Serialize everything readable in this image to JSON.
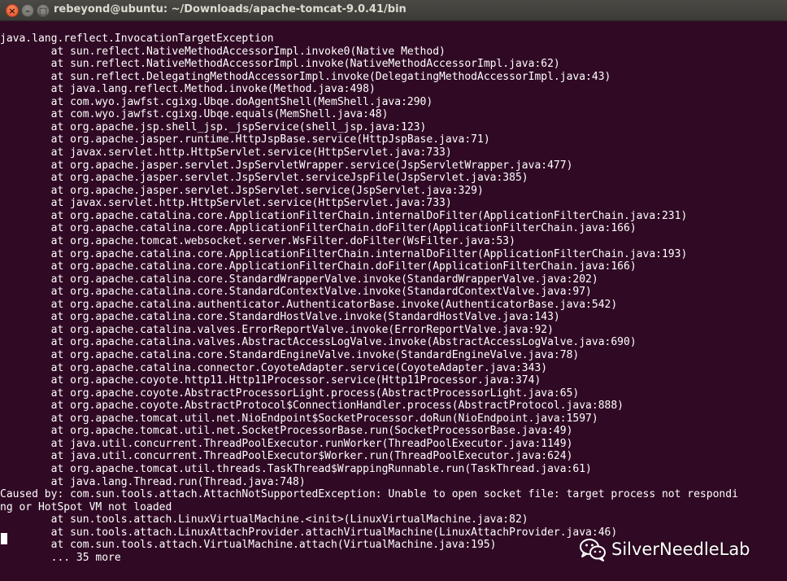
{
  "window": {
    "title": "rebeyond@ubuntu: ~/Downloads/apache-tomcat-9.0.41/bin",
    "close_glyph": "×",
    "minimize_glyph": "–",
    "maximize_glyph": "□"
  },
  "terminal": {
    "lines": [
      "java.lang.reflect.InvocationTargetException",
      "\tat sun.reflect.NativeMethodAccessorImpl.invoke0(Native Method)",
      "\tat sun.reflect.NativeMethodAccessorImpl.invoke(NativeMethodAccessorImpl.java:62)",
      "\tat sun.reflect.DelegatingMethodAccessorImpl.invoke(DelegatingMethodAccessorImpl.java:43)",
      "\tat java.lang.reflect.Method.invoke(Method.java:498)",
      "\tat com.wyo.jawfst.cgixg.Ubqe.doAgentShell(MemShell.java:290)",
      "\tat com.wyo.jawfst.cgixg.Ubqe.equals(MemShell.java:48)",
      "\tat org.apache.jsp.shell_jsp._jspService(shell_jsp.java:123)",
      "\tat org.apache.jasper.runtime.HttpJspBase.service(HttpJspBase.java:71)",
      "\tat javax.servlet.http.HttpServlet.service(HttpServlet.java:733)",
      "\tat org.apache.jasper.servlet.JspServletWrapper.service(JspServletWrapper.java:477)",
      "\tat org.apache.jasper.servlet.JspServlet.serviceJspFile(JspServlet.java:385)",
      "\tat org.apache.jasper.servlet.JspServlet.service(JspServlet.java:329)",
      "\tat javax.servlet.http.HttpServlet.service(HttpServlet.java:733)",
      "\tat org.apache.catalina.core.ApplicationFilterChain.internalDoFilter(ApplicationFilterChain.java:231)",
      "\tat org.apache.catalina.core.ApplicationFilterChain.doFilter(ApplicationFilterChain.java:166)",
      "\tat org.apache.tomcat.websocket.server.WsFilter.doFilter(WsFilter.java:53)",
      "\tat org.apache.catalina.core.ApplicationFilterChain.internalDoFilter(ApplicationFilterChain.java:193)",
      "\tat org.apache.catalina.core.ApplicationFilterChain.doFilter(ApplicationFilterChain.java:166)",
      "\tat org.apache.catalina.core.StandardWrapperValve.invoke(StandardWrapperValve.java:202)",
      "\tat org.apache.catalina.core.StandardContextValve.invoke(StandardContextValve.java:97)",
      "\tat org.apache.catalina.authenticator.AuthenticatorBase.invoke(AuthenticatorBase.java:542)",
      "\tat org.apache.catalina.core.StandardHostValve.invoke(StandardHostValve.java:143)",
      "\tat org.apache.catalina.valves.ErrorReportValve.invoke(ErrorReportValve.java:92)",
      "\tat org.apache.catalina.valves.AbstractAccessLogValve.invoke(AbstractAccessLogValve.java:690)",
      "\tat org.apache.catalina.core.StandardEngineValve.invoke(StandardEngineValve.java:78)",
      "\tat org.apache.catalina.connector.CoyoteAdapter.service(CoyoteAdapter.java:343)",
      "\tat org.apache.coyote.http11.Http11Processor.service(Http11Processor.java:374)",
      "\tat org.apache.coyote.AbstractProcessorLight.process(AbstractProcessorLight.java:65)",
      "\tat org.apache.coyote.AbstractProtocol$ConnectionHandler.process(AbstractProtocol.java:888)",
      "\tat org.apache.tomcat.util.net.NioEndpoint$SocketProcessor.doRun(NioEndpoint.java:1597)",
      "\tat org.apache.tomcat.util.net.SocketProcessorBase.run(SocketProcessorBase.java:49)",
      "\tat java.util.concurrent.ThreadPoolExecutor.runWorker(ThreadPoolExecutor.java:1149)",
      "\tat java.util.concurrent.ThreadPoolExecutor$Worker.run(ThreadPoolExecutor.java:624)",
      "\tat org.apache.tomcat.util.threads.TaskThread$WrappingRunnable.run(TaskThread.java:61)",
      "\tat java.lang.Thread.run(Thread.java:748)",
      "Caused by: com.sun.tools.attach.AttachNotSupportedException: Unable to open socket file: target process not respondi",
      "ng or HotSpot VM not loaded",
      "\tat sun.tools.attach.LinuxVirtualMachine.<init>(LinuxVirtualMachine.java:82)",
      "\tat sun.tools.attach.LinuxAttachProvider.attachVirtualMachine(LinuxAttachProvider.java:46)",
      "\tat com.sun.tools.attach.VirtualMachine.attach(VirtualMachine.java:195)",
      "\t... 35 more"
    ]
  },
  "watermark": {
    "text": "SilverNeedleLab",
    "icon": "wechat-icon"
  }
}
